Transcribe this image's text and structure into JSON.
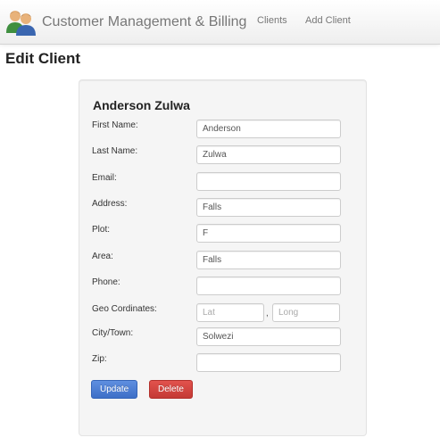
{
  "navbar": {
    "brand": "Customer Management & Billing",
    "links": [
      "Clients",
      "Add Client"
    ]
  },
  "page": {
    "title": "Edit Client"
  },
  "client": {
    "name": "Anderson Zulwa"
  },
  "form": {
    "first_name": {
      "label": "First Name:",
      "value": "Anderson"
    },
    "last_name": {
      "label": "Last Name:",
      "value": "Zulwa"
    },
    "email": {
      "label": "Email:",
      "value": ""
    },
    "address": {
      "label": "Address:",
      "value": "Falls"
    },
    "plot": {
      "label": "Plot:",
      "value": "F"
    },
    "area": {
      "label": "Area:",
      "value": "Falls"
    },
    "phone": {
      "label": "Phone:",
      "value": ""
    },
    "geo": {
      "label": "Geo Cordinates:",
      "lat_placeholder": "Lat",
      "long_placeholder": "Long",
      "separator": ","
    },
    "city": {
      "label": "City/Town:",
      "value": "Solwezi"
    },
    "zip": {
      "label": "Zip:",
      "value": ""
    }
  },
  "buttons": {
    "update": "Update",
    "delete": "Delete"
  },
  "colors": {
    "update_button": "#4a7fd8",
    "delete_button": "#d9443f",
    "well_background": "#f5f5f5",
    "nav_text": "#777777"
  },
  "icons": {
    "logo": "users-icon"
  }
}
